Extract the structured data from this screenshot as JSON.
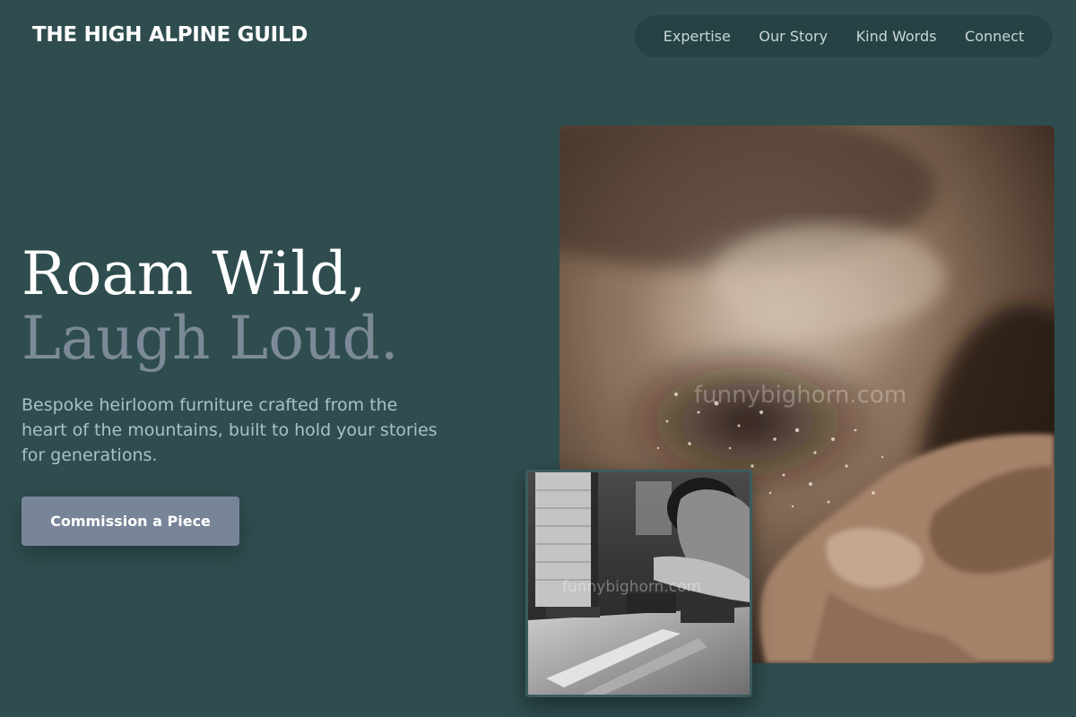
{
  "brand": {
    "name": "THE HIGH ALPINE GUILD"
  },
  "nav": {
    "items": [
      {
        "label": "Expertise"
      },
      {
        "label": "Our Story"
      },
      {
        "label": "Kind Words"
      },
      {
        "label": "Connect"
      }
    ]
  },
  "hero": {
    "headline_line1": "Roam Wild,",
    "headline_line2": "Laugh Loud.",
    "subtitle": "Bespoke heirloom furniture crafted from the heart of the mountains, built to hold your stories for generations.",
    "cta_label": "Commission a Piece"
  },
  "images": {
    "hero_watermark": "funnybighorn.com",
    "inset_watermark": "funnybighorn.com"
  },
  "colors": {
    "background": "#2f4d4f",
    "nav_background": "#274244",
    "accent_button": "#788598",
    "headline_muted": "#7c8a98"
  }
}
